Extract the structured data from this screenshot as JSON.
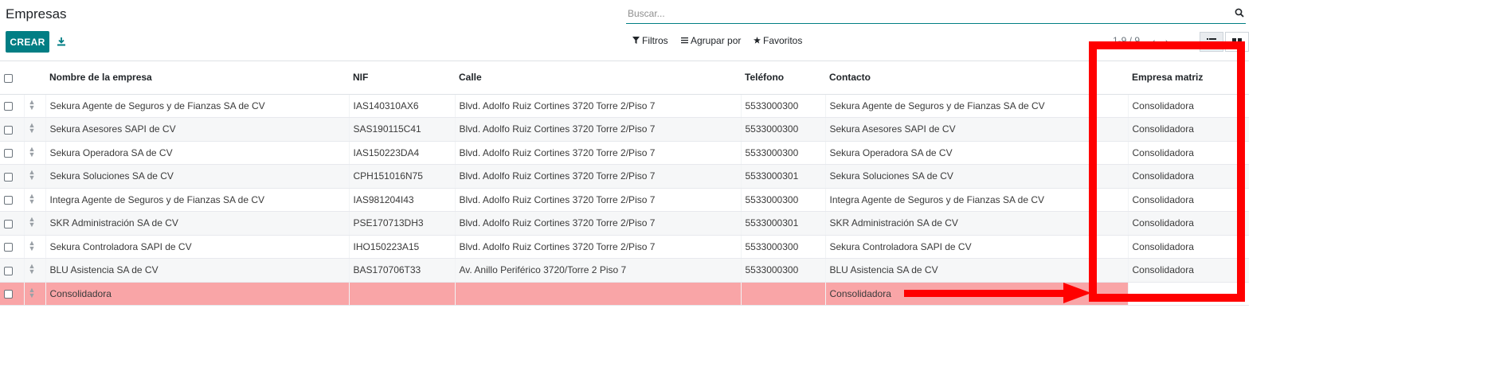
{
  "header": {
    "title": "Empresas",
    "search_placeholder": "Buscar...",
    "create_label": "CREAR",
    "filters_label": "Filtros",
    "group_label": "Agrupar por",
    "favorites_label": "Favoritos",
    "pager": "1-9 / 9"
  },
  "columns": {
    "name": "Nombre de la empresa",
    "nif": "NIF",
    "street": "Calle",
    "phone": "Teléfono",
    "contact": "Contacto",
    "parent": "Empresa matriz"
  },
  "rows": [
    {
      "name": "Sekura Agente de Seguros y de Fianzas SA de CV",
      "nif": "IAS140310AX6",
      "street": "Blvd. Adolfo Ruiz Cortines 3720 Torre 2/Piso 7",
      "phone": "5533000300",
      "contact": "Sekura Agente de Seguros y de Fianzas SA de CV",
      "parent": "Consolidadora"
    },
    {
      "name": "Sekura Asesores SAPI de CV",
      "nif": "SAS190115C41",
      "street": "Blvd. Adolfo Ruiz Cortines 3720 Torre 2/Piso 7",
      "phone": "5533000300",
      "contact": "Sekura Asesores SAPI de CV",
      "parent": "Consolidadora"
    },
    {
      "name": "Sekura Operadora SA de CV",
      "nif": "IAS150223DA4",
      "street": "Blvd. Adolfo Ruiz Cortines 3720 Torre 2/Piso 7",
      "phone": "5533000300",
      "contact": "Sekura Operadora SA de CV",
      "parent": "Consolidadora"
    },
    {
      "name": "Sekura Soluciones SA de CV",
      "nif": "CPH151016N75",
      "street": "Blvd. Adolfo Ruiz Cortines 3720 Torre 2/Piso 7",
      "phone": "5533000301",
      "contact": "Sekura Soluciones SA de CV",
      "parent": "Consolidadora"
    },
    {
      "name": "Integra Agente de Seguros y de Fianzas SA de CV",
      "nif": "IAS981204I43",
      "street": "Blvd. Adolfo Ruiz Cortines 3720 Torre 2/Piso 7",
      "phone": "5533000300",
      "contact": "Integra Agente de Seguros y de Fianzas SA de CV",
      "parent": "Consolidadora"
    },
    {
      "name": "SKR Administración SA de CV",
      "nif": "PSE170713DH3",
      "street": "Blvd. Adolfo Ruiz Cortines 3720 Torre 2/Piso 7",
      "phone": "5533000301",
      "contact": "SKR Administración SA de CV",
      "parent": "Consolidadora"
    },
    {
      "name": "Sekura Controladora SAPI de CV",
      "nif": "IHO150223A15",
      "street": "Blvd. Adolfo Ruiz Cortines 3720 Torre 2/Piso 7",
      "phone": "5533000300",
      "contact": "Sekura Controladora SAPI de CV",
      "parent": "Consolidadora"
    },
    {
      "name": "BLU Asistencia SA de CV",
      "nif": "BAS170706T33",
      "street": "Av. Anillo Periférico 3720/Torre 2 Piso 7",
      "phone": "5533000300",
      "contact": "BLU Asistencia SA de CV",
      "parent": "Consolidadora"
    },
    {
      "name": "Consolidadora",
      "nif": "",
      "street": "",
      "phone": "",
      "contact": "Consolidadora",
      "parent": ""
    }
  ],
  "colors": {
    "accent": "#017e84",
    "highlight_row": "#f9a5a7",
    "annotation": "#ff0000"
  },
  "icons": {
    "search": "search-icon",
    "download": "download-icon",
    "filter": "filter-icon",
    "group": "list-icon",
    "favorites": "star-icon",
    "list_view": "list-view-icon",
    "kanban_view": "kanban-view-icon"
  }
}
